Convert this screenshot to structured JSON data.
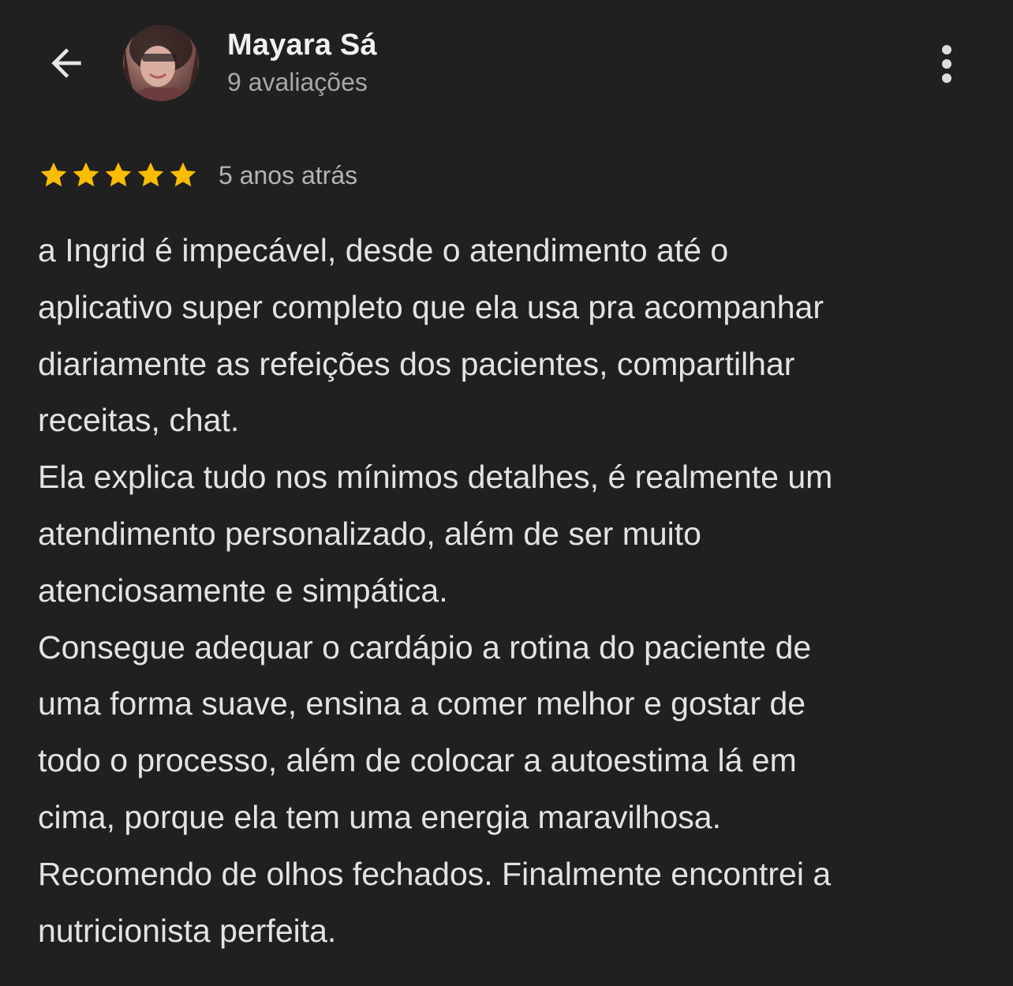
{
  "header": {
    "back_icon": "arrow-left-icon",
    "reviewer_name": "Mayara Sá",
    "review_count": "9 avaliações",
    "more_icon": "more-vertical-icon"
  },
  "review": {
    "rating": 5,
    "rating_max": 5,
    "star_color": "#fbbc04",
    "time_ago": "5 anos atrás",
    "lines": [
      "a Ingrid é impecável, desde o atendimento até o",
      "aplicativo super completo que ela usa pra acompanhar",
      "diariamente as refeições dos pacientes, compartilhar",
      "receitas, chat.",
      "Ela explica tudo nos mínimos detalhes, é realmente um",
      "atendimento personalizado, além de ser muito",
      "atenciosamente e simpática.",
      "Consegue adequar o cardápio a rotina do paciente de",
      "uma forma suave, ensina a comer melhor e gostar de",
      "todo o processo, além de colocar a autoestima lá em",
      "cima, porque ela tem uma energia maravilhosa.",
      "Recomendo de olhos fechados. Finalmente encontrei a",
      "nutricionista perfeita."
    ]
  },
  "colors": {
    "background": "#202020",
    "text_primary": "#e3e3e3",
    "text_secondary": "#a8a8a8"
  }
}
